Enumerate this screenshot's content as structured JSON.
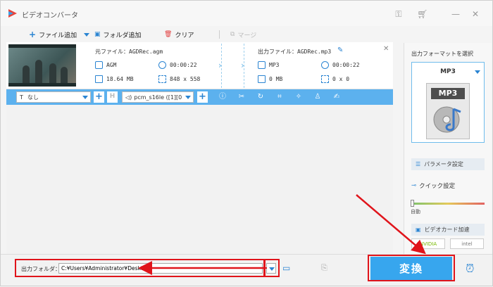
{
  "window": {
    "title": "ビデオコンバータ"
  },
  "toolbar": {
    "add_file": "ファイル追加",
    "add_folder": "フォルダ追加",
    "clear": "クリア",
    "merge": "マージ"
  },
  "file": {
    "source_label": "元ファイル：AGDRec.agm",
    "output_label": "出力ファイル：AGDRec.mp3",
    "source_format": "AGM",
    "source_duration": "00:00:22",
    "source_size": "18.64 MB",
    "source_resolution": "848 x 558",
    "output_format": "MP3",
    "output_duration": "00:00:22",
    "output_size": "0 MB",
    "output_resolution": "0 x 0"
  },
  "editbar": {
    "subtitle_select": "なし",
    "audio_select": "pcm_s16le ([1][0"
  },
  "panel": {
    "title": "出力フォーマットを選択",
    "format_name": "MP3",
    "format_tile": "MP3",
    "param_button": "パラメータ設定",
    "quick_setting": "クイック設定",
    "auto_label": "自動",
    "gpu_button": "ビデオカード加速",
    "nvidia": "NVIDIA",
    "intel": "intel"
  },
  "bottom": {
    "output_folder_label": "出力フォルダ：",
    "output_path": "C:¥Users¥Administrator¥Desktop",
    "convert_label": "変換"
  },
  "colors": {
    "accent": "#37a6ee",
    "annotation": "#e0141b"
  }
}
